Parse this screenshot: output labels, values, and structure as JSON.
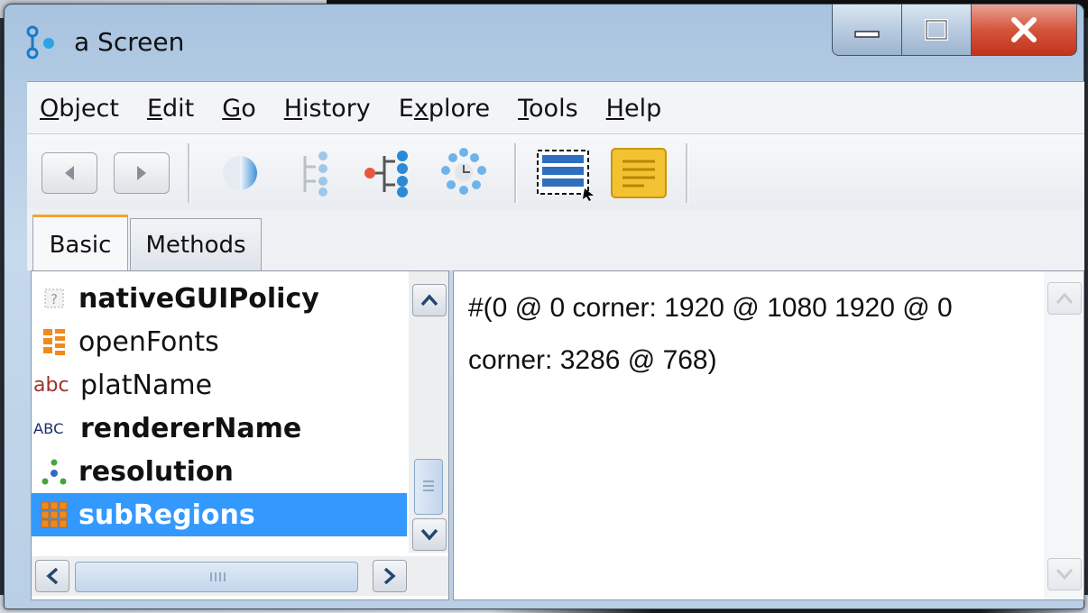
{
  "window": {
    "title": "a Screen"
  },
  "menu": [
    "Object",
    "Edit",
    "Go",
    "History",
    "Explore",
    "Tools",
    "Help"
  ],
  "menu_mnemonics": [
    "O",
    "E",
    "G",
    "H",
    "E",
    "T",
    "H"
  ],
  "tabs": [
    {
      "label": "Basic",
      "active": true
    },
    {
      "label": "Methods",
      "active": false
    }
  ],
  "items": [
    {
      "label": "nativeGUIPolicy",
      "bold": true,
      "icon": "unknown-icon"
    },
    {
      "label": "openFonts",
      "bold": false,
      "icon": "collection-icon"
    },
    {
      "label": "platName",
      "bold": false,
      "icon": "string-icon"
    },
    {
      "label": "rendererName",
      "bold": true,
      "icon": "symbol-icon"
    },
    {
      "label": "resolution",
      "bold": true,
      "icon": "point-icon"
    },
    {
      "label": "subRegions",
      "bold": true,
      "icon": "array-icon",
      "selected": true
    }
  ],
  "value": "#(0 @ 0 corner: 1920 @ 1080 1920 @ 0 corner: 3286 @ 768)",
  "colors": {
    "selection": "#3399ff",
    "tab_accent": "#f0a431",
    "close": "#c1341c"
  }
}
